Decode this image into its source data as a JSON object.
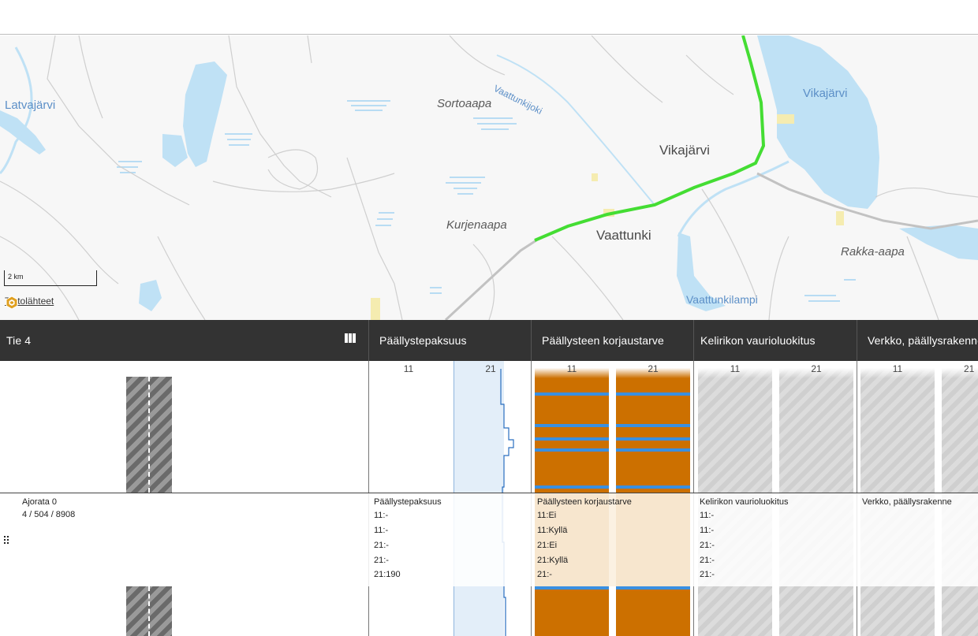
{
  "map": {
    "places": {
      "latvajarvi": "Latvajärvi",
      "sortoaapa": "Sortoaapa",
      "vaattunkijoki": "Vaattunkijoki",
      "vikajarvi_lake": "Vikajärvi",
      "vikajarvi_town": "Vikajärvi",
      "kurjenaapa": "Kurjenaapa",
      "vaattunki": "Vaattunki",
      "rakka_aapa": "Rakka-aapa",
      "vaattunkilampi": "Vaattunkilampi"
    },
    "scale_label": "2 km",
    "sources_label": "Tietolähteet",
    "colors": {
      "highlight_route": "#44dd33",
      "water": "#bfe1f5",
      "road": "#c4c4c4"
    }
  },
  "table": {
    "columns": [
      {
        "title": "Tie 4"
      },
      {
        "title": "Päällystepaksuus"
      },
      {
        "title": "Päällysteen korjaustarve"
      },
      {
        "title": "Kelirikon vaurioluokitus"
      },
      {
        "title": "Verkko, päällysrakenne"
      }
    ],
    "lanes": [
      "11",
      "21"
    ],
    "colors": {
      "repair": "#cc7000",
      "repair_line": "#3a8fe0",
      "thickness": "#e3eef9",
      "header": "#333333"
    }
  },
  "popup": {
    "road": {
      "title": "Ajorata 0",
      "address": "4 / 504 / 8908"
    },
    "thickness": {
      "title": "Päällystepaksuus",
      "rows": [
        "11:-",
        "11:-",
        "21:-",
        "21:-",
        "21:190"
      ]
    },
    "repair": {
      "title": "Päällysteen korjaustarve",
      "rows": [
        "11:Ei",
        "11:Kyllä",
        "21:Ei",
        "21:Kyllä",
        "21:-"
      ]
    },
    "frost": {
      "title": "Kelirikon vaurioluokitus",
      "rows": [
        "11:-",
        "11:-",
        "21:-",
        "21:-",
        "21:-"
      ]
    },
    "network": {
      "title": "Verkko, päällysrakenne"
    }
  }
}
